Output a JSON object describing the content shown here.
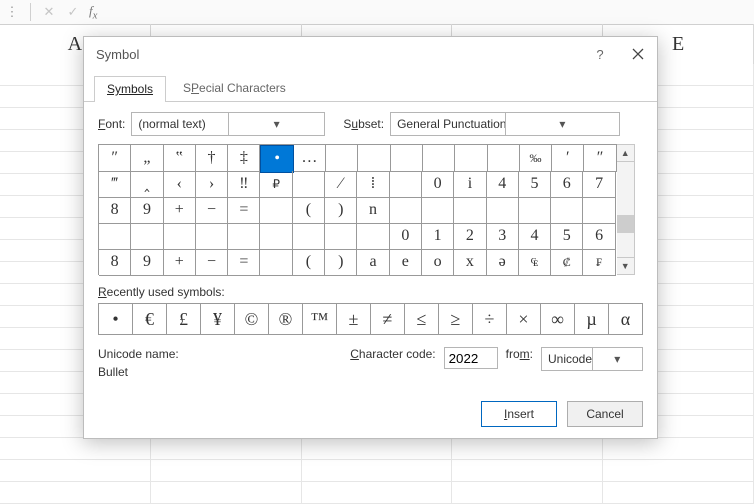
{
  "columns": [
    "A",
    "",
    "",
    "",
    "E"
  ],
  "dialog": {
    "title": "Symbol"
  },
  "tabs": {
    "symbols": "Symbols",
    "special": "Special Characters",
    "special_u": "P"
  },
  "font": {
    "label": "Font:",
    "label_u": "F",
    "value": "(normal text)"
  },
  "subset": {
    "label": "Subset:",
    "label_u": "u",
    "value": "General Punctuation"
  },
  "symgrid": [
    [
      "″",
      "„",
      "‟",
      "†",
      "‡",
      "•",
      "…",
      " ",
      " ",
      " ",
      " ",
      " ",
      " ",
      "‰",
      "′",
      "″"
    ],
    [
      "‴",
      "‸",
      "‹",
      "›",
      "‼",
      "₽",
      " ",
      "⁄",
      "⁞",
      " ",
      "0",
      "i",
      "4",
      "5",
      "6",
      "7"
    ],
    [
      "8",
      "9",
      "+",
      "−",
      "=",
      " ",
      "(",
      ")",
      "n",
      " ",
      " ",
      " ",
      " ",
      " ",
      " ",
      " "
    ],
    [
      " ",
      " ",
      " ",
      " ",
      " ",
      " ",
      " ",
      " ",
      " ",
      "0",
      "1",
      "2",
      "3",
      "4",
      "5",
      "6"
    ],
    [
      "8",
      "9",
      "+",
      "−",
      "=",
      " ",
      "(",
      ")",
      "a",
      "e",
      "o",
      "x",
      "ə",
      "₠",
      "₡",
      "₣"
    ]
  ],
  "sel_row": 0,
  "sel_col": 5,
  "recent": {
    "label": "Recently used symbols:",
    "label_u": "R",
    "items": [
      "•",
      "€",
      "£",
      "¥",
      "©",
      "®",
      "™",
      "±",
      "≠",
      "≤",
      "≥",
      "÷",
      "×",
      "∞",
      "µ",
      "α"
    ]
  },
  "unicode": {
    "name_label": "Unicode name:",
    "name": "Bullet",
    "code_label": "Character code:",
    "code_u": "C",
    "code": "2022",
    "from_label": "from:",
    "from_u": "m",
    "from_value": "Unicode (hex)"
  },
  "buttons": {
    "insert": "Insert",
    "insert_u": "I",
    "cancel": "Cancel"
  }
}
